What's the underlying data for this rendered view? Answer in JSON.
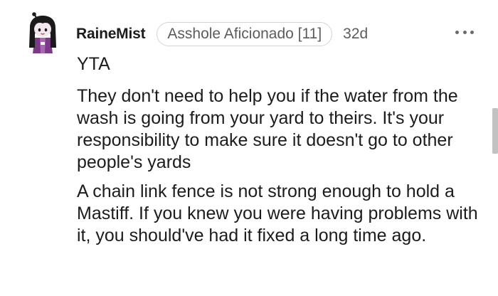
{
  "comment": {
    "username": "RaineMist",
    "flair": "Asshole Aficionado [11]",
    "age": "32d",
    "more_icon": "more-horizontal-icon",
    "paragraphs": [
      "YTA",
      "They don't need to help you if the water from the wash is going from your yard to theirs. It's your responsibility to make sure it doesn't go to other people's yards",
      "A chain link fence is not strong enough to hold a Mastiff. If you knew you were having problems with it, you should've had it fixed a long time ago."
    ]
  },
  "colors": {
    "text": "#1c1c1c",
    "muted": "#5c5c5c",
    "flair_border": "#d4d4d4",
    "scrollbar": "#c2c2c2"
  }
}
